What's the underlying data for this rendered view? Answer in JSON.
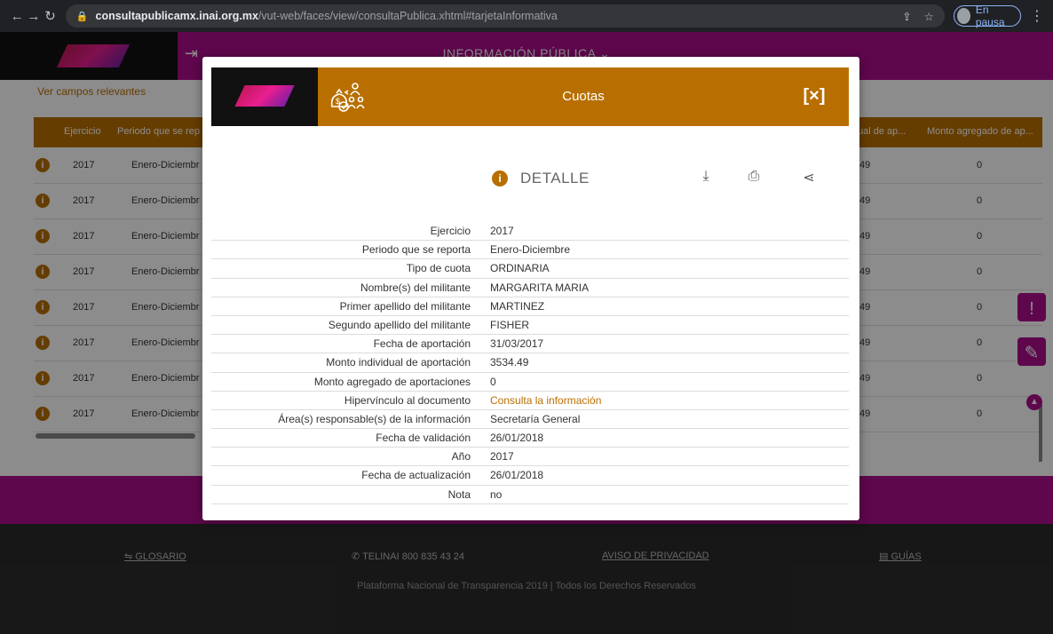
{
  "browser": {
    "back_icon": "back-arrow-icon",
    "url_host": "consultapublicamx.inai.org.mx",
    "url_path": "/vut-web/faces/view/consultaPublica.xhtml#tarjetaInformativa",
    "profile_label": "En pausa"
  },
  "topbar": {
    "menu_label": "INFORMACIÓN PÚBLICA ⌄"
  },
  "page": {
    "ver_campos": "Ver campos relevantes",
    "table_headers": [
      "Ejercicio",
      "Periodo que se rep",
      "ual de ap...",
      "Monto agregado de ap..."
    ],
    "rows": [
      {
        "ejercicio": "2017",
        "periodo": "Enero-Diciembr",
        "monto_ind": "49",
        "monto_agr": "0"
      },
      {
        "ejercicio": "2017",
        "periodo": "Enero-Diciembr",
        "monto_ind": "49",
        "monto_agr": "0"
      },
      {
        "ejercicio": "2017",
        "periodo": "Enero-Diciembr",
        "monto_ind": "49",
        "monto_agr": "0"
      },
      {
        "ejercicio": "2017",
        "periodo": "Enero-Diciembr",
        "monto_ind": "49",
        "monto_agr": "0"
      },
      {
        "ejercicio": "2017",
        "periodo": "Enero-Diciembr",
        "monto_ind": "49",
        "monto_agr": "0"
      },
      {
        "ejercicio": "2017",
        "periodo": "Enero-Diciembr",
        "monto_ind": "49",
        "monto_agr": "0"
      },
      {
        "ejercicio": "2017",
        "periodo": "Enero-Diciembr",
        "monto_ind": "49",
        "monto_agr": "0"
      },
      {
        "ejercicio": "2017",
        "periodo": "Enero-Diciembr",
        "monto_ind": "49",
        "monto_agr": "0"
      }
    ]
  },
  "footer": {
    "glosario": "GLOSARIO",
    "telinai": "TELINAI 800 835 43 24",
    "aviso": "AVISO DE PRIVACIDAD",
    "guias": "GUÍAS",
    "copyright": "Plataforma Nacional de Transparencia 2019 | Todos los Derechos Reservados"
  },
  "modal": {
    "title": "Cuotas",
    "close_label": "[×]",
    "detail_label": "DETALLE",
    "fields": [
      {
        "label": "Ejercicio",
        "value": "2017"
      },
      {
        "label": "Periodo que se reporta",
        "value": "Enero-Diciembre"
      },
      {
        "label": "Tipo de cuota",
        "value": "ORDINARIA"
      },
      {
        "label": "Nombre(s) del militante",
        "value": "MARGARITA MARIA"
      },
      {
        "label": "Primer apellido del militante",
        "value": "MARTINEZ"
      },
      {
        "label": "Segundo apellido del militante",
        "value": "FISHER"
      },
      {
        "label": "Fecha de aportación",
        "value": "31/03/2017"
      },
      {
        "label": "Monto individual de aportación",
        "value": "3534.49"
      },
      {
        "label": "Monto agregado de aportaciones",
        "value": "0"
      },
      {
        "label": "Hipervínculo al documento",
        "value": "Consulta la información"
      },
      {
        "label": "Área(s) responsable(s) de la información",
        "value": "Secretaría General"
      },
      {
        "label": "Fecha de validación",
        "value": "26/01/2018"
      },
      {
        "label": "Año",
        "value": "2017"
      },
      {
        "label": "Fecha de actualización",
        "value": "26/01/2018"
      },
      {
        "label": "Nota",
        "value": "no"
      }
    ]
  },
  "colors": {
    "accent": "#b86f00",
    "brand": "#ad0d8c"
  }
}
